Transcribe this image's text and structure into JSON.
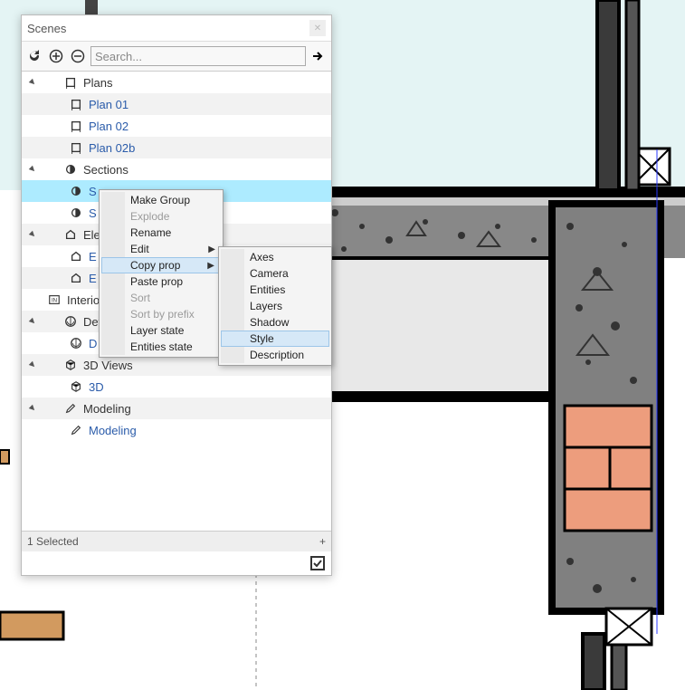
{
  "panel": {
    "title": "Scenes",
    "search_placeholder": "Search...",
    "status": "1 Selected",
    "status_plus": "+",
    "groups": [
      {
        "label": "Plans",
        "icon": "plan-icon",
        "items": [
          {
            "label": "Plan 01"
          },
          {
            "label": "Plan 02"
          },
          {
            "label": "Plan 02b"
          }
        ]
      },
      {
        "label": "Sections",
        "icon": "section-icon",
        "items": [
          {
            "label": "S",
            "selected": true
          },
          {
            "label": "S"
          }
        ]
      },
      {
        "label": "Eleva",
        "icon": "elevation-icon",
        "items": [
          {
            "label": "E"
          },
          {
            "label": "E"
          }
        ]
      },
      {
        "label": "Interio",
        "icon": "interior-icon",
        "items": []
      },
      {
        "label": "Detail",
        "icon": "detail-icon",
        "items": [
          {
            "label": "D"
          }
        ]
      },
      {
        "label": "3D Views",
        "icon": "3d-icon",
        "items": [
          {
            "label": "3D"
          }
        ]
      },
      {
        "label": "Modeling",
        "icon": "pencil-icon",
        "items": [
          {
            "label": "Modeling"
          }
        ]
      }
    ]
  },
  "context_menu_1": {
    "items": [
      {
        "label": "Make Group"
      },
      {
        "label": "Explode",
        "disabled": true
      },
      {
        "label": "Rename"
      },
      {
        "label": "Edit",
        "submenu": true
      },
      {
        "label": "Copy prop",
        "submenu": true,
        "highlight": true
      },
      {
        "label": "Paste prop"
      },
      {
        "label": "Sort",
        "disabled": true
      },
      {
        "label": "Sort by prefix",
        "disabled": true
      },
      {
        "label": "Layer state"
      },
      {
        "label": "Entities state"
      }
    ]
  },
  "context_menu_2": {
    "items": [
      {
        "label": "Axes"
      },
      {
        "label": "Camera"
      },
      {
        "label": "Entities"
      },
      {
        "label": "Layers"
      },
      {
        "label": "Shadow"
      },
      {
        "label": "Style",
        "highlight": true
      },
      {
        "label": "Description"
      }
    ]
  }
}
